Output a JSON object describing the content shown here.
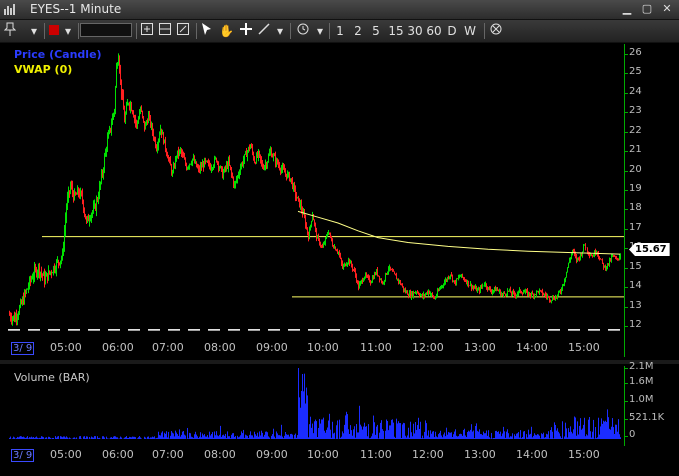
{
  "window": {
    "title": "EYES--1 Minute"
  },
  "toolbar": {
    "timeframes": [
      "1",
      "2",
      "5",
      "15",
      "30",
      "60",
      "D",
      "W"
    ]
  },
  "price_pane": {
    "legend_price": "Price (Candle)",
    "legend_vwap": "VWAP (0)",
    "y_labels": [
      "26",
      "25",
      "24",
      "23",
      "22",
      "21",
      "20",
      "19",
      "18",
      "17",
      "16",
      "15",
      "14",
      "13",
      "12"
    ],
    "last_price": "15.67",
    "colors": {
      "up": "#00e000",
      "down": "#ff2020",
      "vwap": "#ffff66",
      "support": "#ffff66",
      "legend_price": "#2a3cff"
    }
  },
  "volume_pane": {
    "legend": "Volume (BAR)",
    "y_labels": [
      "2.1M",
      "1.6M",
      "1.0M",
      "521.1K",
      "0"
    ],
    "bar_color": "#1b2cff"
  },
  "x_axis": {
    "date_label": "3/ 9",
    "time_labels": [
      "05:00",
      "06:00",
      "07:00",
      "08:00",
      "09:00",
      "10:00",
      "11:00",
      "12:00",
      "13:00",
      "14:00",
      "15:00"
    ]
  },
  "chart_data": {
    "type": "candlestick",
    "ylim": [
      11.6,
      26.5
    ],
    "horizontal_lines": [
      16.6,
      13.5,
      11.8
    ],
    "last_price": 15.67,
    "path_points": [
      [
        0,
        12.6
      ],
      [
        6,
        12.4
      ],
      [
        12,
        13.0
      ],
      [
        18,
        13.8
      ],
      [
        24,
        14.6
      ],
      [
        30,
        15.0
      ],
      [
        36,
        14.4
      ],
      [
        42,
        14.8
      ],
      [
        48,
        15.2
      ],
      [
        54,
        15.6
      ],
      [
        58,
        18.2
      ],
      [
        62,
        19.2
      ],
      [
        66,
        18.6
      ],
      [
        70,
        18.9
      ],
      [
        74,
        18.5
      ],
      [
        78,
        17.3
      ],
      [
        82,
        17.8
      ],
      [
        86,
        18.0
      ],
      [
        90,
        18.8
      ],
      [
        94,
        19.9
      ],
      [
        98,
        21.3
      ],
      [
        102,
        22.2
      ],
      [
        106,
        23.2
      ],
      [
        108,
        25.3
      ],
      [
        110,
        26.1
      ],
      [
        112,
        24.6
      ],
      [
        116,
        22.6
      ],
      [
        120,
        23.6
      ],
      [
        124,
        23.2
      ],
      [
        128,
        22.3
      ],
      [
        132,
        23.2
      ],
      [
        136,
        22.2
      ],
      [
        140,
        22.8
      ],
      [
        144,
        22.0
      ],
      [
        148,
        21.2
      ],
      [
        152,
        22.2
      ],
      [
        156,
        21.4
      ],
      [
        160,
        20.6
      ],
      [
        164,
        19.8
      ],
      [
        168,
        20.8
      ],
      [
        172,
        21.0
      ],
      [
        178,
        20.2
      ],
      [
        184,
        20.6
      ],
      [
        190,
        20.0
      ],
      [
        196,
        20.4
      ],
      [
        202,
        20.2
      ],
      [
        208,
        20.6
      ],
      [
        214,
        19.8
      ],
      [
        220,
        20.4
      ],
      [
        226,
        19.2
      ],
      [
        232,
        20.2
      ],
      [
        238,
        20.9
      ],
      [
        242,
        21.3
      ],
      [
        246,
        20.5
      ],
      [
        250,
        20.8
      ],
      [
        254,
        20.2
      ],
      [
        258,
        20.4
      ],
      [
        262,
        21.0
      ],
      [
        266,
        20.6
      ],
      [
        270,
        20.3
      ],
      [
        276,
        19.9
      ],
      [
        282,
        19.6
      ],
      [
        288,
        18.6
      ],
      [
        292,
        18.2
      ],
      [
        296,
        17.5
      ],
      [
        300,
        16.6
      ],
      [
        304,
        17.8
      ],
      [
        308,
        16.6
      ],
      [
        314,
        16.0
      ],
      [
        320,
        16.9
      ],
      [
        324,
        16.2
      ],
      [
        330,
        15.8
      ],
      [
        334,
        15.0
      ],
      [
        340,
        15.4
      ],
      [
        346,
        14.8
      ],
      [
        350,
        14.0
      ],
      [
        356,
        14.6
      ],
      [
        362,
        14.3
      ],
      [
        368,
        14.8
      ],
      [
        374,
        14.2
      ],
      [
        380,
        15.0
      ],
      [
        386,
        14.6
      ],
      [
        392,
        14.2
      ],
      [
        396,
        13.8
      ],
      [
        402,
        13.6
      ],
      [
        408,
        13.8
      ],
      [
        414,
        13.5
      ],
      [
        420,
        13.8
      ],
      [
        426,
        13.4
      ],
      [
        432,
        14.0
      ],
      [
        438,
        14.4
      ],
      [
        442,
        14.7
      ],
      [
        446,
        14.2
      ],
      [
        452,
        14.6
      ],
      [
        458,
        14.3
      ],
      [
        464,
        14.0
      ],
      [
        470,
        13.8
      ],
      [
        476,
        14.2
      ],
      [
        482,
        13.8
      ],
      [
        488,
        13.9
      ],
      [
        494,
        13.6
      ],
      [
        500,
        13.8
      ],
      [
        506,
        13.6
      ],
      [
        512,
        13.8
      ],
      [
        518,
        13.7
      ],
      [
        524,
        13.6
      ],
      [
        530,
        13.8
      ],
      [
        536,
        13.6
      ],
      [
        542,
        13.4
      ],
      [
        548,
        13.5
      ],
      [
        552,
        13.8
      ],
      [
        556,
        14.4
      ],
      [
        560,
        15.2
      ],
      [
        564,
        15.9
      ],
      [
        568,
        15.4
      ],
      [
        572,
        15.6
      ],
      [
        576,
        16.2
      ],
      [
        580,
        15.8
      ],
      [
        584,
        15.6
      ],
      [
        588,
        15.9
      ],
      [
        592,
        15.4
      ],
      [
        596,
        15.0
      ],
      [
        600,
        15.2
      ],
      [
        604,
        15.6
      ],
      [
        608,
        15.4
      ],
      [
        612,
        15.67
      ]
    ],
    "vwap_points": [
      [
        290,
        17.9
      ],
      [
        310,
        17.6
      ],
      [
        330,
        17.3
      ],
      [
        350,
        16.9
      ],
      [
        370,
        16.55
      ],
      [
        400,
        16.3
      ],
      [
        440,
        16.1
      ],
      [
        480,
        15.95
      ],
      [
        520,
        15.85
      ],
      [
        560,
        15.78
      ],
      [
        600,
        15.72
      ],
      [
        612,
        15.7
      ]
    ]
  }
}
